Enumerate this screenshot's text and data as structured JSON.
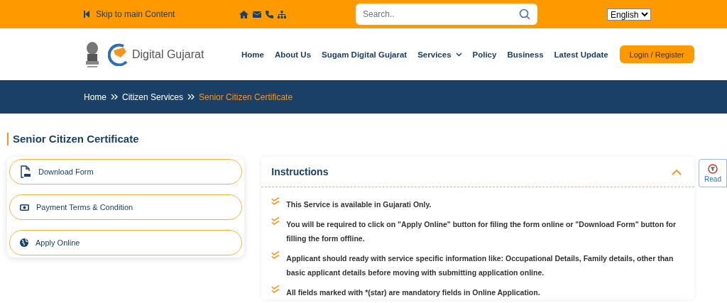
{
  "top_bar": {
    "skip_link": "Skip to main Content",
    "search": {
      "placeholder": "Search.."
    },
    "language": {
      "value": "English"
    }
  },
  "header": {
    "logo_text": "Digital Gujarat",
    "nav": [
      {
        "label": "Home",
        "dropdown": false
      },
      {
        "label": "About Us",
        "dropdown": false
      },
      {
        "label": "Sugam Digital Gujarat",
        "dropdown": false
      },
      {
        "label": "Services",
        "dropdown": true
      },
      {
        "label": "Policy",
        "dropdown": false
      },
      {
        "label": "Business",
        "dropdown": false
      },
      {
        "label": "Latest Update",
        "dropdown": false
      }
    ],
    "login_button": "Login / Register"
  },
  "breadcrumb": [
    {
      "label": "Home",
      "current": false
    },
    {
      "label": "Citizen Services",
      "current": false
    },
    {
      "label": "Senior Citizen Certificate",
      "current": true
    }
  ],
  "page_title": "Senior Citizen Certificate",
  "actions": [
    {
      "label": "Download Form",
      "kind": "pdf"
    },
    {
      "label": "Payment Terms & Condition",
      "kind": "money"
    },
    {
      "label": "Apply Online",
      "kind": "globe"
    }
  ],
  "instructions": {
    "title": "Instructions",
    "expanded": true,
    "items": [
      "This Service is available in Gujarati Only.",
      "You will be required to click on \"Apply Online\" button for filing the form online or \"Download Form\" button for filling the form offline.",
      "Applicant should ready with service specific information like: Occupational Details, Family details, other than basic applicant details before moving with submitting application online.",
      "All fields marked with *(star) are mandatory fields in Online Application."
    ]
  },
  "read_button": "Read"
}
